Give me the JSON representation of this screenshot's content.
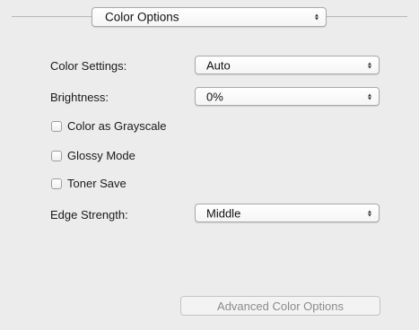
{
  "header": {
    "popup_value": "Color Options"
  },
  "form": {
    "color_settings": {
      "label": "Color Settings:",
      "value": "Auto"
    },
    "brightness": {
      "label": "Brightness:",
      "value": "0%"
    },
    "color_as_grayscale": {
      "label": "Color as Grayscale",
      "checked": false
    },
    "glossy_mode": {
      "label": "Glossy Mode",
      "checked": false
    },
    "toner_save": {
      "label": "Toner Save",
      "checked": false
    },
    "edge_strength": {
      "label": "Edge Strength:",
      "value": "Middle"
    }
  },
  "advanced_button": {
    "label": "Advanced Color Options",
    "enabled": false
  }
}
